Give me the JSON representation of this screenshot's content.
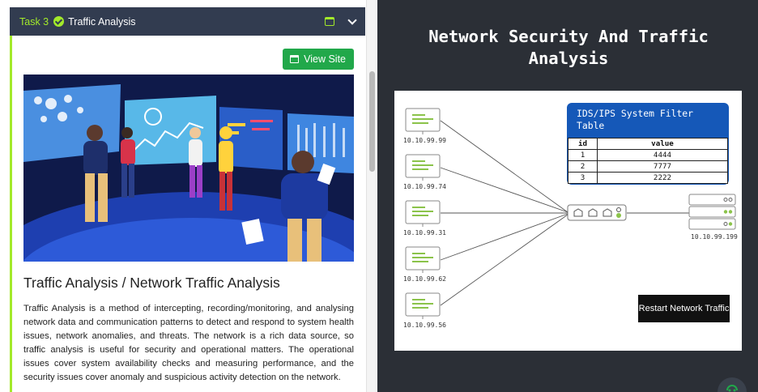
{
  "task": {
    "number_label": "Task 3",
    "title": "Traffic Analysis"
  },
  "view_site_label": "View Site",
  "article": {
    "title": "Traffic Analysis / Network Traffic Analysis",
    "body": "Traffic Analysis is a method of intercepting, recording/monitoring, and analysing network data and communication patterns to detect and respond to system health issues, network anomalies, and threats. The network is a rich data source, so traffic analysis is useful for security and operational matters. The operational issues cover system availability checks and measuring performance, and the security issues cover anomaly and suspicious activity detection on the network."
  },
  "right_panel": {
    "title_line1": "Network Security And Traffic",
    "title_line2": "Analysis",
    "hosts": [
      "10.10.99.99",
      "10.10.99.74",
      "10.10.99.31",
      "10.10.99.62",
      "10.10.99.56"
    ],
    "server_label": "10.10.99.199",
    "filter_table": {
      "title": "IDS/IPS System Filter Table",
      "headers": [
        "id",
        "value"
      ],
      "rows": [
        [
          "1",
          "4444"
        ],
        [
          "2",
          "7777"
        ],
        [
          "3",
          "2222"
        ]
      ]
    },
    "restart_label": "Restart Network Traffic"
  },
  "colors": {
    "accent_green": "#a3ea2a",
    "button_green": "#21a84a",
    "ids_blue": "#1558b8",
    "header_navy": "#323c50"
  },
  "icons": [
    "check-circle-icon",
    "calendar-icon",
    "chevron-down-icon",
    "window-icon",
    "computer-icon",
    "switch-icon",
    "server-icon",
    "chat-bot-icon"
  ]
}
